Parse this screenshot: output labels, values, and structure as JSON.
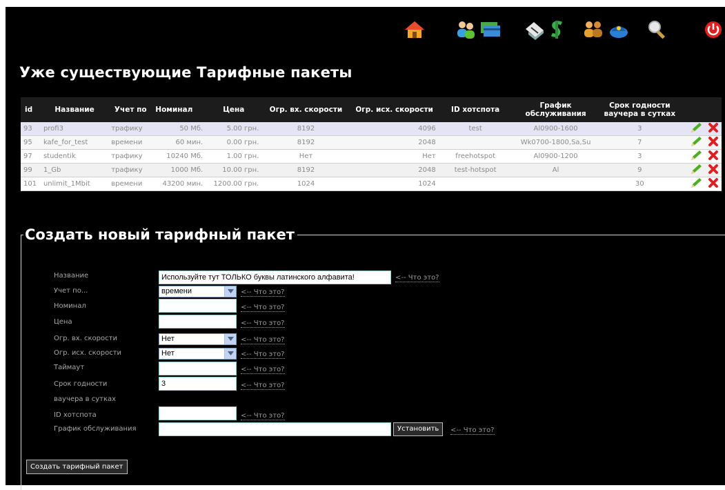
{
  "toolbar": {
    "icons": [
      "home-icon",
      "users-icon",
      "cards-icon",
      "vouchers-icon",
      "tariffs-icon",
      "groups-icon",
      "admin-icon",
      "search-icon",
      "power-icon"
    ]
  },
  "page_title": "Уже существующие Тарифные пакеты",
  "table": {
    "headers": {
      "id": "id",
      "name": "Название",
      "accounting": "Учет по",
      "nominal": "Номинал",
      "price": "Цена",
      "limit_in": "Огр. вх. скорости",
      "limit_out": "Огр. исх. скорости",
      "hotspot": "ID хотспота",
      "schedule": "График обслуживания",
      "expiry_line1": "Срок годности",
      "expiry_line2": "ваучера в сутках"
    },
    "rows": [
      {
        "id": "93",
        "name": "profi3",
        "accounting": "трафику",
        "nominal": "50 Мб.",
        "price": "5.00 грн.",
        "limit_in": "8192",
        "limit_out": "4096",
        "hotspot": "test",
        "schedule": "Al0900-1600",
        "expiry": "3"
      },
      {
        "id": "95",
        "name": "kafe_for_test",
        "accounting": "времени",
        "nominal": "60 мин.",
        "price": "0.00 грн.",
        "limit_in": "8192",
        "limit_out": "2048",
        "hotspot": "",
        "schedule": "Wk0700-1800,Sa,Su",
        "expiry": "7"
      },
      {
        "id": "97",
        "name": "studentik",
        "accounting": "трафику",
        "nominal": "10240 Мб.",
        "price": "1.00 грн.",
        "limit_in": "Нет",
        "limit_out": "Нет",
        "hotspot": "freehotspot",
        "schedule": "Al0900-1200",
        "expiry": "3"
      },
      {
        "id": "99",
        "name": "1_Gb",
        "accounting": "трафику",
        "nominal": "1000 Мб.",
        "price": "10.00 грн.",
        "limit_in": "8192",
        "limit_out": "2048",
        "hotspot": "test-hotspot",
        "schedule": "Al",
        "expiry": "9"
      },
      {
        "id": "101",
        "name": "unlimit_1Mbit",
        "accounting": "времени",
        "nominal": "43200 мин.",
        "price": "1200.00 грн.",
        "limit_in": "1024",
        "limit_out": "1024",
        "hotspot": "",
        "schedule": "",
        "expiry": "30"
      }
    ]
  },
  "create_form": {
    "legend": "Создать новый тарифный пакет",
    "fields": {
      "name_label": "Название",
      "name_value": "Используйте тут ТОЛЬКО буквы латинского алфавита!",
      "accounting_label": "Учет по...",
      "accounting_value": "времени",
      "nominal_label": "Номинал",
      "nominal_value": "",
      "price_label": "Цена",
      "price_value": "",
      "limit_in_label": "Огр. вх. скорости",
      "limit_in_value": "Нет",
      "limit_out_label": "Огр. исх. скорости",
      "limit_out_value": "Нет",
      "timeout_label": "Таймаут",
      "timeout_value": "",
      "expiry_label_line1": "Срок годности",
      "expiry_label_line2": "ваучера в сутках",
      "expiry_value": "3",
      "hotspot_label": "ID хотспота",
      "hotspot_value": "",
      "schedule_label": "График обслуживания",
      "schedule_value": ""
    },
    "help_text": "<-- Что это?",
    "set_button": "Установить",
    "submit_button": "Создать тарифный пакет"
  },
  "colors": {
    "background": "#000000",
    "header_row": "#1c1c1c",
    "row_highlight": "#e4e4f4",
    "edit_icon": "#4caf20",
    "delete_icon": "#e02020"
  }
}
